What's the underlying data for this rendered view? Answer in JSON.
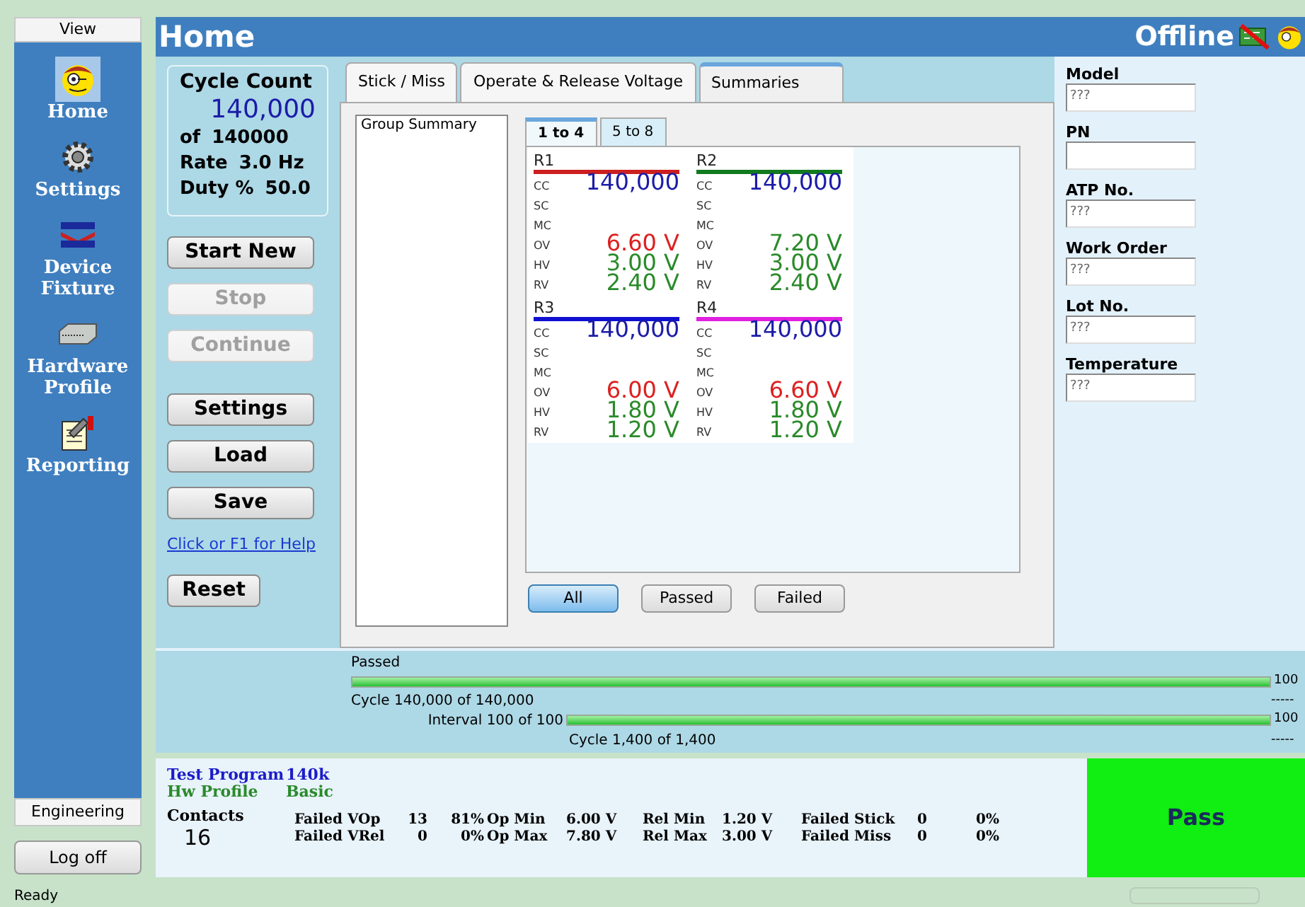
{
  "sidebar": {
    "header": "View",
    "items": [
      {
        "label": "Home",
        "kind": "face",
        "selected": true
      },
      {
        "label": "Settings",
        "kind": "gear",
        "selected": false
      },
      {
        "label": "Device Fixture",
        "kind": "fixture",
        "selected": false
      },
      {
        "label": "Hardware Profile",
        "kind": "hardware",
        "selected": false
      },
      {
        "label": "Reporting",
        "kind": "report",
        "selected": false
      }
    ],
    "footer": "Engineering",
    "logoff": "Log off"
  },
  "header": {
    "title": "Home",
    "status": "Offline"
  },
  "cycle_count": {
    "title": "Cycle Count",
    "value": "140,000",
    "lines": [
      [
        "of",
        "140000"
      ],
      [
        "Rate",
        "3.0 Hz"
      ],
      [
        "Duty %",
        "50.0"
      ]
    ]
  },
  "buttons": [
    {
      "label": "Start New",
      "disabled": false
    },
    {
      "label": "Stop",
      "disabled": true
    },
    {
      "label": "Continue",
      "disabled": true
    },
    {
      "label": "Settings",
      "disabled": false
    },
    {
      "label": "Load",
      "disabled": false
    },
    {
      "label": "Save",
      "disabled": false
    }
  ],
  "help_link": "Click or F1 for Help",
  "reset": "Reset",
  "tabs": [
    {
      "label": "Stick / Miss",
      "selected": false
    },
    {
      "label": "Operate & Release Voltage",
      "selected": false
    },
    {
      "label": "Summaries",
      "selected": true
    }
  ],
  "group_list": {
    "items": [
      "Group Summary"
    ]
  },
  "subtabs": [
    {
      "label": "1 to 4",
      "selected": true
    },
    {
      "label": "5 to 8",
      "selected": false
    }
  ],
  "relays": [
    {
      "name": "R1",
      "color": "#cc1f1f",
      "rows": [
        {
          "label": "CC",
          "value": "140,000",
          "kind": "count"
        },
        {
          "label": "SC"
        },
        {
          "label": "MC"
        },
        {
          "label": "OV",
          "value": "6.60 V",
          "kind": "volt",
          "ok": false
        },
        {
          "label": "HV",
          "value": "3.00 V",
          "kind": "volt",
          "ok": true
        },
        {
          "label": "RV",
          "value": "2.40 V",
          "kind": "volt",
          "ok": true
        }
      ]
    },
    {
      "name": "R2",
      "color": "#117a1e",
      "rows": [
        {
          "label": "CC",
          "value": "140,000",
          "kind": "count"
        },
        {
          "label": "SC"
        },
        {
          "label": "MC"
        },
        {
          "label": "OV",
          "value": "7.20 V",
          "kind": "volt",
          "ok": true
        },
        {
          "label": "HV",
          "value": "3.00 V",
          "kind": "volt",
          "ok": true
        },
        {
          "label": "RV",
          "value": "2.40 V",
          "kind": "volt",
          "ok": true
        }
      ]
    },
    {
      "name": "R3",
      "color": "#1010d0",
      "rows": [
        {
          "label": "CC",
          "value": "140,000",
          "kind": "count"
        },
        {
          "label": "SC"
        },
        {
          "label": "MC"
        },
        {
          "label": "OV",
          "value": "6.00 V",
          "kind": "volt",
          "ok": false
        },
        {
          "label": "HV",
          "value": "1.80 V",
          "kind": "volt",
          "ok": true
        },
        {
          "label": "RV",
          "value": "1.20 V",
          "kind": "volt",
          "ok": true
        }
      ]
    },
    {
      "name": "R4",
      "color": "#e020e0",
      "rows": [
        {
          "label": "CC",
          "value": "140,000",
          "kind": "count"
        },
        {
          "label": "SC"
        },
        {
          "label": "MC"
        },
        {
          "label": "OV",
          "value": "6.60 V",
          "kind": "volt",
          "ok": false
        },
        {
          "label": "HV",
          "value": "1.80 V",
          "kind": "volt",
          "ok": true
        },
        {
          "label": "RV",
          "value": "1.20 V",
          "kind": "volt",
          "ok": true
        }
      ]
    }
  ],
  "filters": [
    {
      "label": "All",
      "selected": true
    },
    {
      "label": "Passed",
      "selected": false
    },
    {
      "label": "Failed",
      "selected": false
    }
  ],
  "fields": [
    {
      "label": "Model",
      "value": "???"
    },
    {
      "label": "PN"
    },
    {
      "label": "ATP No.",
      "value": "???"
    },
    {
      "label": "Work Order",
      "value": "???"
    },
    {
      "label": "Lot No.",
      "value": "???"
    },
    {
      "label": "Temperature",
      "value": "???"
    }
  ],
  "progress": {
    "caption": "Passed",
    "bars": [
      {
        "label": "Cycle 140,000 of 140,000",
        "level": 1,
        "percent": "100",
        "dashes": "-----"
      },
      {
        "prefix": "Interval 100 of 100",
        "label": "Cycle 1,400 of 1,400",
        "level": 1,
        "percent": "100",
        "dashes": "-----"
      }
    ]
  },
  "info": {
    "program_label": "Test Program",
    "program": "140k",
    "profile_label": "Hw Profile",
    "profile": "Basic",
    "contacts_label": "Contacts",
    "contacts": "16",
    "stats": [
      [
        "Failed VOp",
        "13",
        "81%",
        "Op Min",
        "6.00 V",
        "Rel Min",
        "1.20 V",
        "Failed Stick",
        "0",
        "0%"
      ],
      [
        "Failed VRel",
        "0",
        "0%",
        "Op Max",
        "7.80 V",
        "Rel Max",
        "3.00 V",
        "Failed Miss",
        "0",
        "0%"
      ]
    ]
  },
  "result": {
    "label": "Pass",
    "passed": true
  },
  "status_bar": "Ready"
}
